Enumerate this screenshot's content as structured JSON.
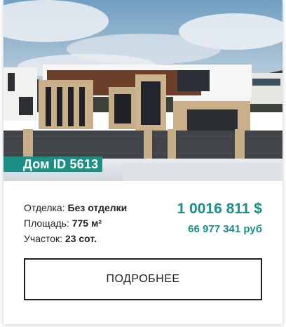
{
  "listing": {
    "title": "Дом ID 5613",
    "image_alt": "Фото дома",
    "properties": [
      {
        "label": "Отделка:",
        "value": "Без отделки"
      },
      {
        "label": "Площадь:",
        "value": "775 м²"
      },
      {
        "label": "Участок:",
        "value": "23 сот."
      }
    ],
    "price_usd": "1 0016 811 $",
    "price_rub": "66 977 341 руб",
    "more_button_label": "ПОДРОБНЕЕ"
  },
  "colors": {
    "accent": "#1a8f85",
    "text": "#222222",
    "button_border": "#1f1f1f"
  }
}
